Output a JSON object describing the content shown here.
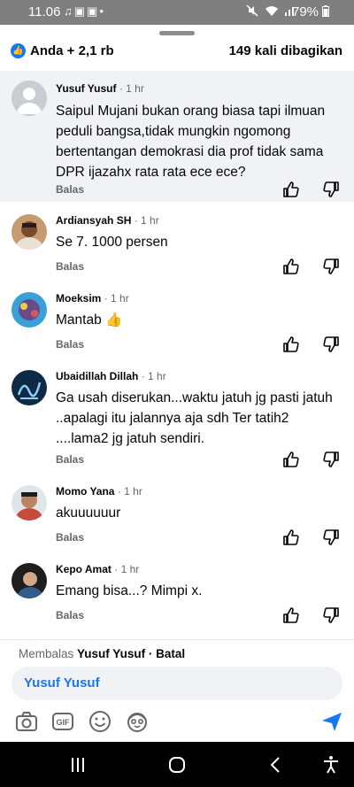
{
  "status_bar": {
    "time": "11.06",
    "battery": "79%",
    "left_icons": [
      "tiktok-icon",
      "instagram-icon",
      "instagram-icon",
      "dot-icon"
    ],
    "right_icons": [
      "mute-icon",
      "wifi-icon",
      "signal-icon",
      "battery-icon"
    ]
  },
  "header": {
    "reactions_label": "Anda + 2,1 rb",
    "shares_label": "149 kali dibagikan"
  },
  "comments": [
    {
      "author": "Yusuf Yusuf",
      "time": "· 1 hr",
      "text": "Saipul Mujani bukan orang biasa tapi ilmuan peduli bangsa,tidak mungkin  ngomong bertentangan demokrasi dia prof tidak sama DPR ijazahx rata rata ece ece?",
      "reply_label": "Balas",
      "avatar": "default-avatar"
    },
    {
      "author": "Ardiansyah SH",
      "time": "· 1 hr",
      "text": "Se 7. 1000 persen",
      "reply_label": "Balas",
      "avatar": "photo-avatar"
    },
    {
      "author": "Moeksim",
      "time": "· 1 hr",
      "text": "Mantab",
      "emoji": "👍",
      "reply_label": "Balas",
      "avatar": "photo-avatar"
    },
    {
      "author": "Ubaidillah Dillah",
      "time": "· 1 hr",
      "text": "Ga usah diserukan...waktu jatuh jg pasti jatuh ..apalagi itu jalannya aja sdh Ter tatih2 ....lama2 jg jatuh sendiri.",
      "reply_label": "Balas",
      "avatar": "calligraphy-avatar"
    },
    {
      "author": "Momo Yana",
      "time": "· 1 hr",
      "text": "akuuuuuur",
      "reply_label": "Balas",
      "avatar": "photo-avatar"
    },
    {
      "author": "Kepo Amat",
      "time": "· 1 hr",
      "text": "Emang bisa...? Mimpi x.",
      "reply_label": "Balas",
      "avatar": "photo-avatar"
    }
  ],
  "reply_bar": {
    "prefix": "Membalas",
    "target": "Yusuf Yusuf",
    "cancel": "· Batal",
    "input_value": "Yusuf Yusuf",
    "tools": [
      "camera-icon",
      "gif-icon",
      "emoji-icon",
      "avatar-sticker-icon"
    ],
    "send_icon": "send-icon"
  },
  "nav_bar": {
    "buttons": [
      "recent-apps-icon",
      "home-icon",
      "back-icon",
      "accessibility-icon"
    ]
  },
  "colors": {
    "accent": "#1877f2",
    "muted": "#65676b",
    "highlight": "#f0f2f5",
    "status_bar": "#7f7f7f"
  }
}
